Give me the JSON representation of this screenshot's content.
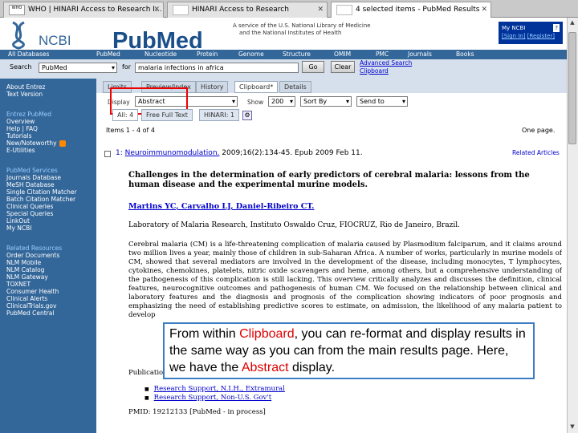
{
  "browser": {
    "tabs": [
      {
        "label": "WHO | HINARI Access to Research I...",
        "favicon": "WHO"
      },
      {
        "label": "HINARI Access to Research"
      },
      {
        "label": "4 selected items - PubMed Results"
      }
    ]
  },
  "header": {
    "ncbi_logo": "NCBI",
    "pubmed_logo": "PubMed",
    "service_line1": "A service of the U.S. National Library of Medicine",
    "service_line2": "and the National Institutes of Health",
    "my_ncbi": "My NCBI",
    "help_icon": "?",
    "sign_in": "[Sign In]",
    "register": "[Register]"
  },
  "nav": [
    "All Databases",
    "PubMed",
    "Nucleotide",
    "Protein",
    "Genome",
    "Structure",
    "OMIM",
    "PMC",
    "Journals",
    "Books"
  ],
  "search": {
    "label": "Search",
    "db": "PubMed",
    "for_label": "for",
    "query": "malaria infections in africa",
    "go": "Go",
    "clear": "Clear",
    "advanced": "Advanced Search",
    "clipboard": "Clipboard"
  },
  "sidebar": {
    "top": [
      "About Entrez",
      "Text Version"
    ],
    "sections": [
      {
        "heading": "Entrez PubMed",
        "items": [
          "Overview",
          "Help | FAQ",
          "Tutorials",
          "New/Noteworthy",
          "E-Utilities"
        ]
      },
      {
        "heading": "PubMed Services",
        "items": [
          "Journals Database",
          "MeSH Database",
          "Single Citation Matcher",
          "Batch Citation Matcher",
          "Clinical Queries",
          "Special Queries",
          "LinkOut",
          "My NCBI"
        ]
      },
      {
        "heading": "Related Resources",
        "items": [
          "Order Documents",
          "NLM Mobile",
          "NLM Catalog",
          "NLM Gateway",
          "TOXNET",
          "Consumer Health",
          "Clinical Alerts",
          "ClinicalTrials.gov",
          "PubMed Central"
        ]
      }
    ]
  },
  "page_tabs": [
    "Limits",
    "Preview/Index",
    "History",
    "Clipboard*",
    "Details"
  ],
  "display_row": {
    "display_label": "Display",
    "display_value": "Abstract",
    "show_label": "Show",
    "show_value": "200",
    "sort_value": "Sort By",
    "send_value": "Send to"
  },
  "sub_tabs": [
    "All: 4",
    "Free Full Text",
    "HINARI: 1"
  ],
  "items_text": "Items 1 - 4 of 4",
  "one_page": "One page.",
  "result": {
    "number": "1:",
    "journal": "Neuroimmunomodulation.",
    "citation": "2009;16(2):134-45. Epub 2009 Feb 11.",
    "related": "Related Articles",
    "title": "Challenges in the determination of early predictors of cerebral malaria: lessons from the human disease and the experimental murine models.",
    "authors": "Martins YC, Carvalho LJ, Daniel-Ribeiro CT.",
    "affiliation": "Laboratory of Malaria Research, Instituto Oswaldo Cruz, FIOCRUZ, Rio de Janeiro, Brazil.",
    "abstract": "Cerebral malaria (CM) is a life-threatening complication of malaria caused by Plasmodium falciparum, and it claims around two million lives a year, mainly those of children in sub-Saharan Africa. A number of works, particularly in murine models of CM, showed that several mediators are involved in the development of the disease, including monocytes, T lymphocytes, cytokines, chemokines, platelets, nitric oxide scavengers and heme, among others, but a comprehensive understanding of the pathogenesis of this complication is still lacking. This overview critically analyzes and discusses the definition, clinical features, neurocognitive outcomes and pathogenesis of human CM. We focused on the relationship between clinical and laboratory features and the diagnosis and prognosis of the complication showing indicators of poor prognosis and emphasizing the need of establishing predictive scores to estimate, on admission, the likelihood of any malaria patient to develop",
    "pub_types_label": "Publication Types:",
    "pub_types": [
      "Research Support, N.I.H., Extramural",
      "Research Support, Non-U.S. Gov't"
    ],
    "pmid": "PMID: 19212133 [PubMed - in process]"
  },
  "callout": {
    "t1": "From within ",
    "h1": "Clipboard",
    "t2": ", you can re-format and display results in the same way as you can from the main results page.  Here, we have the ",
    "h2": "Abstract",
    "t3": " display."
  },
  "colors": {
    "ncbi_blue": "#336699",
    "highlight_red": "#dd0000",
    "callout_border": "#3b7dc4"
  }
}
